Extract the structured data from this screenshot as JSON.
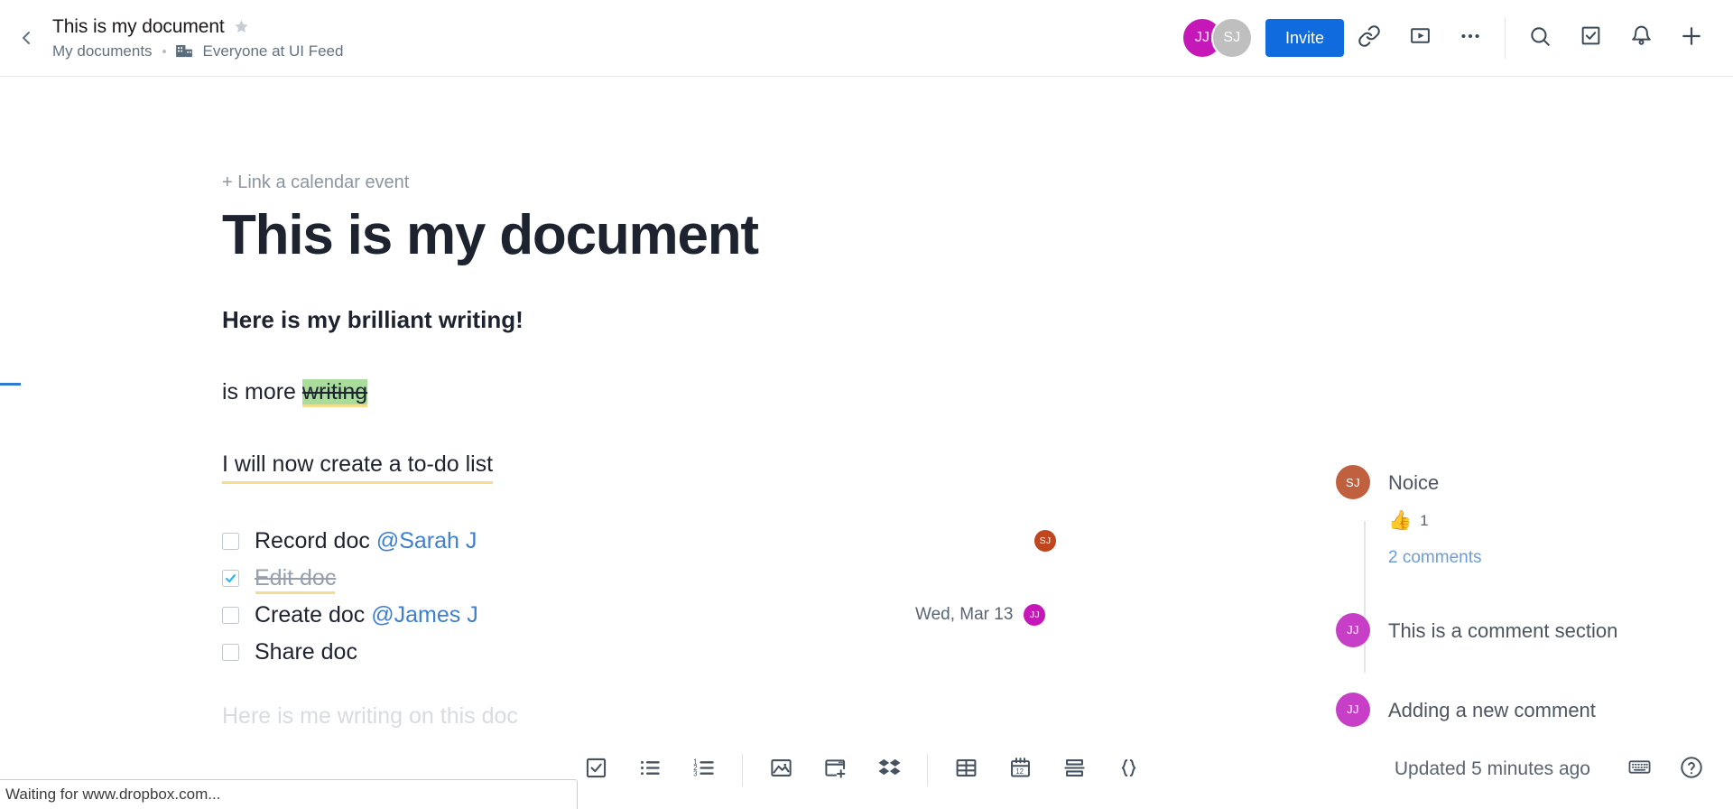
{
  "topbar": {
    "back_icon": "chevron-left-icon",
    "doc_title": "This is my document",
    "star_icon": "star-icon",
    "breadcrumb": "My documents",
    "team_icon": "building-icon",
    "team_name": "Everyone at UI Feed",
    "avatars": [
      {
        "initials": "JJ",
        "color": "#c618b9"
      },
      {
        "initials": "SJ",
        "color": "#bfbfbf"
      }
    ],
    "invite_label": "Invite",
    "icons": [
      "link-icon",
      "video-icon",
      "more-horizontal-icon",
      "search-icon",
      "tasks-icon",
      "bell-icon",
      "plus-icon"
    ]
  },
  "document": {
    "calendar_link": "+ Link a calendar event",
    "heading": "This is my document",
    "subheading": "Here is my brilliant writing!",
    "paragraph": {
      "prefix": "is more ",
      "highlighted": "writing"
    },
    "todo_intro": "I will now create a to-do list",
    "checklist": [
      {
        "label": "Record doc",
        "mention": "@Sarah J",
        "checked": false,
        "date": "",
        "avatar": "SJ",
        "avatar_color": "#c0461f"
      },
      {
        "label": "Edit doc",
        "mention": "",
        "checked": true,
        "date": "",
        "avatar": "",
        "avatar_color": ""
      },
      {
        "label": "Create doc",
        "mention": "@James J",
        "checked": false,
        "date": "Wed, Mar 13",
        "avatar": "JJ",
        "avatar_color": "#c618b9"
      },
      {
        "label": "Share doc",
        "mention": "",
        "checked": false,
        "date": "",
        "avatar": "",
        "avatar_color": ""
      }
    ],
    "faded_line": "Here is me writing on this doc"
  },
  "comments": [
    {
      "initials": "SJ",
      "color": "#c0603f",
      "text": "Noice",
      "reaction_emoji": "👍",
      "reaction_count": "1",
      "more_label": "2 comments"
    },
    {
      "initials": "JJ",
      "color": "#c63fc6",
      "text": "This is a comment section"
    },
    {
      "initials": "JJ",
      "color": "#c63fc6",
      "text": "Adding a new comment"
    }
  ],
  "bottom": {
    "tools": [
      "checklist-icon",
      "bulleted-list-icon",
      "numbered-list-icon",
      "image-icon",
      "embed-icon",
      "dropbox-icon",
      "table-icon",
      "calendar-icon",
      "divider-icon",
      "code-icon"
    ],
    "updated_text": "Updated 5 minutes ago",
    "keyboard_icon": "keyboard-icon",
    "help_icon": "help-circle-icon"
  },
  "browser_status": "Waiting for www.dropbox.com..."
}
